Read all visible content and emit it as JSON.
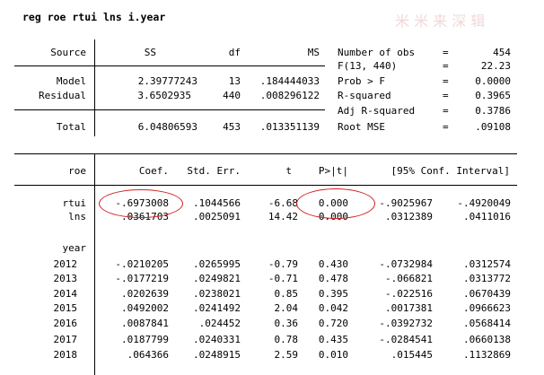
{
  "command": "reg roe rtui lns i.year",
  "anova": {
    "headers": [
      "Source",
      "SS",
      "df",
      "MS"
    ],
    "rows": [
      {
        "source": "Model",
        "ss": "2.39777243",
        "df": "13",
        "ms": ".184444033"
      },
      {
        "source": "Residual",
        "ss": "3.6502935",
        "df": "440",
        "ms": ".008296122"
      }
    ],
    "total": {
      "source": "Total",
      "ss": "6.04806593",
      "df": "453",
      "ms": ".013351139"
    }
  },
  "stats": [
    {
      "label": "Number of obs",
      "eq": "=",
      "value": "454"
    },
    {
      "label": "F(13, 440)",
      "eq": "=",
      "value": "22.23"
    },
    {
      "label": "Prob > F",
      "eq": "=",
      "value": "0.0000"
    },
    {
      "label": "R-squared",
      "eq": "=",
      "value": "0.3965"
    },
    {
      "label": "Adj R-squared",
      "eq": "=",
      "value": "0.3786"
    },
    {
      "label": "Root MSE",
      "eq": "=",
      "value": ".09108"
    }
  ],
  "coef_headers": {
    "var": "roe",
    "coef": "Coef.",
    "se": "Std. Err.",
    "t": "t",
    "p": "P>|t|",
    "ci": "[95% Conf. Interval]"
  },
  "coef_rows": [
    {
      "var": "rtui",
      "coef": "-.6973008",
      "se": ".1044566",
      "t": "-6.68",
      "p": "0.000",
      "lo": "-.9025967",
      "hi": "-.4920049"
    },
    {
      "var": "lns",
      "coef": ".0361703",
      "se": ".0025091",
      "t": "14.42",
      "p": "0.000",
      "lo": ".0312389",
      "hi": ".0411016"
    }
  ],
  "year_label": "year",
  "year_rows": [
    {
      "var": "2012",
      "coef": "-.0210205",
      "se": ".0265995",
      "t": "-0.79",
      "p": "0.430",
      "lo": "-.0732984",
      "hi": ".0312574"
    },
    {
      "var": "2013",
      "coef": "-.0177219",
      "se": ".0249821",
      "t": "-0.71",
      "p": "0.478",
      "lo": "-.066821",
      "hi": ".0313772"
    },
    {
      "var": "2014",
      "coef": ".0202639",
      "se": ".0238021",
      "t": "0.85",
      "p": "0.395",
      "lo": "-.022516",
      "hi": ".0670439"
    },
    {
      "var": "2015",
      "coef": ".0492002",
      "se": ".0241492",
      "t": "2.04",
      "p": "0.042",
      "lo": ".0017381",
      "hi": ".0966623"
    },
    {
      "var": "2016",
      "coef": ".0087841",
      "se": ".024452",
      "t": "0.36",
      "p": "0.720",
      "lo": "-.0392732",
      "hi": ".0568414"
    },
    {
      "var": "2017",
      "coef": ".0187799",
      "se": ".0240331",
      "t": "0.78",
      "p": "0.435",
      "lo": "-.0284541",
      "hi": ".0660138"
    },
    {
      "var": "2018",
      "coef": ".064366",
      "se": ".0248915",
      "t": "2.59",
      "p": "0.010",
      "lo": ".015445",
      "hi": ".1132869"
    }
  ],
  "watermark": "米 米 来 深 辑",
  "colors": {
    "highlight": "#d32020"
  }
}
